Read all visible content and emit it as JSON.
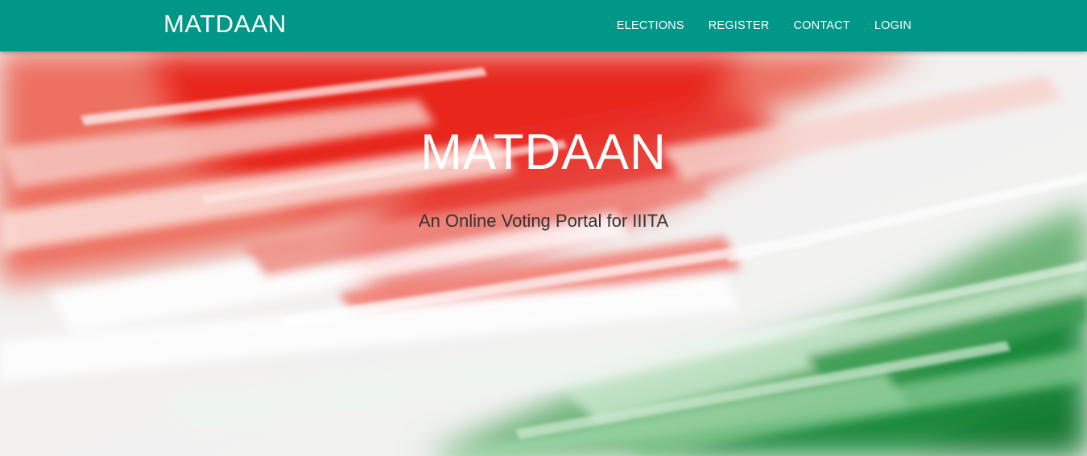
{
  "colors": {
    "navbar": "#009688",
    "hero_red": "#e8251f",
    "hero_white": "#f4f4f4",
    "hero_green": "#1f8a3c"
  },
  "navbar": {
    "brand": "MATDAAN",
    "links": [
      {
        "label": "ELECTIONS"
      },
      {
        "label": "REGISTER"
      },
      {
        "label": "CONTACT"
      },
      {
        "label": "LOGIN"
      }
    ]
  },
  "hero": {
    "title": "MATDAAN",
    "subtitle": "An Online Voting Portal for IIITA",
    "background": "tricolor-brushstroke"
  }
}
